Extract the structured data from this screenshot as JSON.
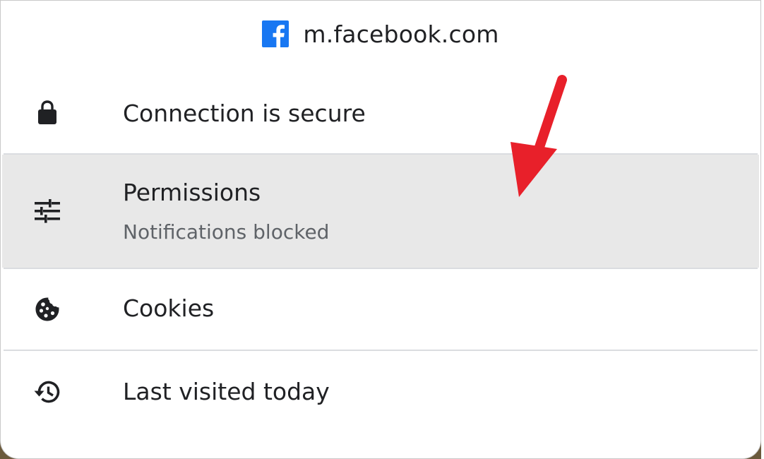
{
  "header": {
    "site": "m.facebook.com",
    "logo_icon": "facebook-icon",
    "logo_color": "#1877f2"
  },
  "items": [
    {
      "icon": "lock-icon",
      "label": "Connection is secure"
    },
    {
      "icon": "tune-sliders-icon",
      "label": "Permissions",
      "sublabel": "Notifications blocked",
      "highlighted": true
    },
    {
      "icon": "cookie-icon",
      "label": "Cookies"
    },
    {
      "icon": "history-icon",
      "label": "Last visited today"
    }
  ],
  "annotation": {
    "arrow_color": "#e8202a"
  }
}
